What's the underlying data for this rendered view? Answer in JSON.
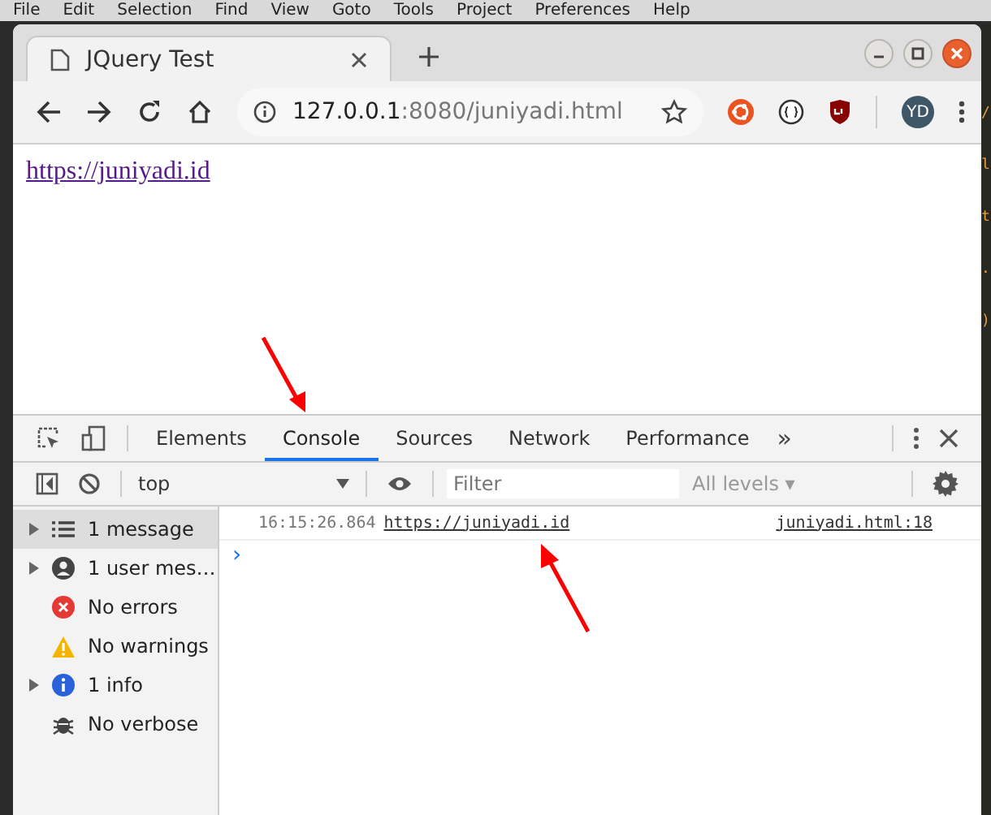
{
  "menu_bar": {
    "items": [
      "File",
      "Edit",
      "Selection",
      "Find",
      "View",
      "Goto",
      "Tools",
      "Project",
      "Preferences",
      "Help"
    ]
  },
  "editor_fragments": [
    "/",
    "l",
    "t",
    ".",
    ")"
  ],
  "browser": {
    "tab": {
      "title": "JQuery Test",
      "selected": true
    },
    "address": {
      "host": "127.0.0.1",
      "rest": ":8080/juniyadi.html"
    },
    "profile": "YD",
    "page": {
      "link": "https://juniyadi.id"
    }
  },
  "devtools": {
    "tabs": [
      {
        "label": "Elements",
        "selected": false
      },
      {
        "label": "Console",
        "selected": true
      },
      {
        "label": "Sources",
        "selected": false
      },
      {
        "label": "Network",
        "selected": false
      },
      {
        "label": "Performance",
        "selected": false
      }
    ],
    "more": "»",
    "context": "top",
    "filter": {
      "placeholder": "Filter"
    },
    "levels": "All levels ▾",
    "sidebar": [
      {
        "kind": "list",
        "label": "1 message",
        "expandable": true,
        "selected": true
      },
      {
        "kind": "user",
        "label": "1 user mes…",
        "expandable": true,
        "selected": false
      },
      {
        "kind": "error",
        "label": "No errors",
        "expandable": false,
        "selected": false
      },
      {
        "kind": "warning",
        "label": "No warnings",
        "expandable": false,
        "selected": false
      },
      {
        "kind": "info",
        "label": "1 info",
        "expandable": true,
        "selected": false
      },
      {
        "kind": "verbose",
        "label": "No verbose",
        "expandable": false,
        "selected": false
      }
    ],
    "messages": [
      {
        "time": "16:15:26.864",
        "text": "https://juniyadi.id",
        "source": "juniyadi.html:18"
      }
    ],
    "prompt": "›"
  }
}
